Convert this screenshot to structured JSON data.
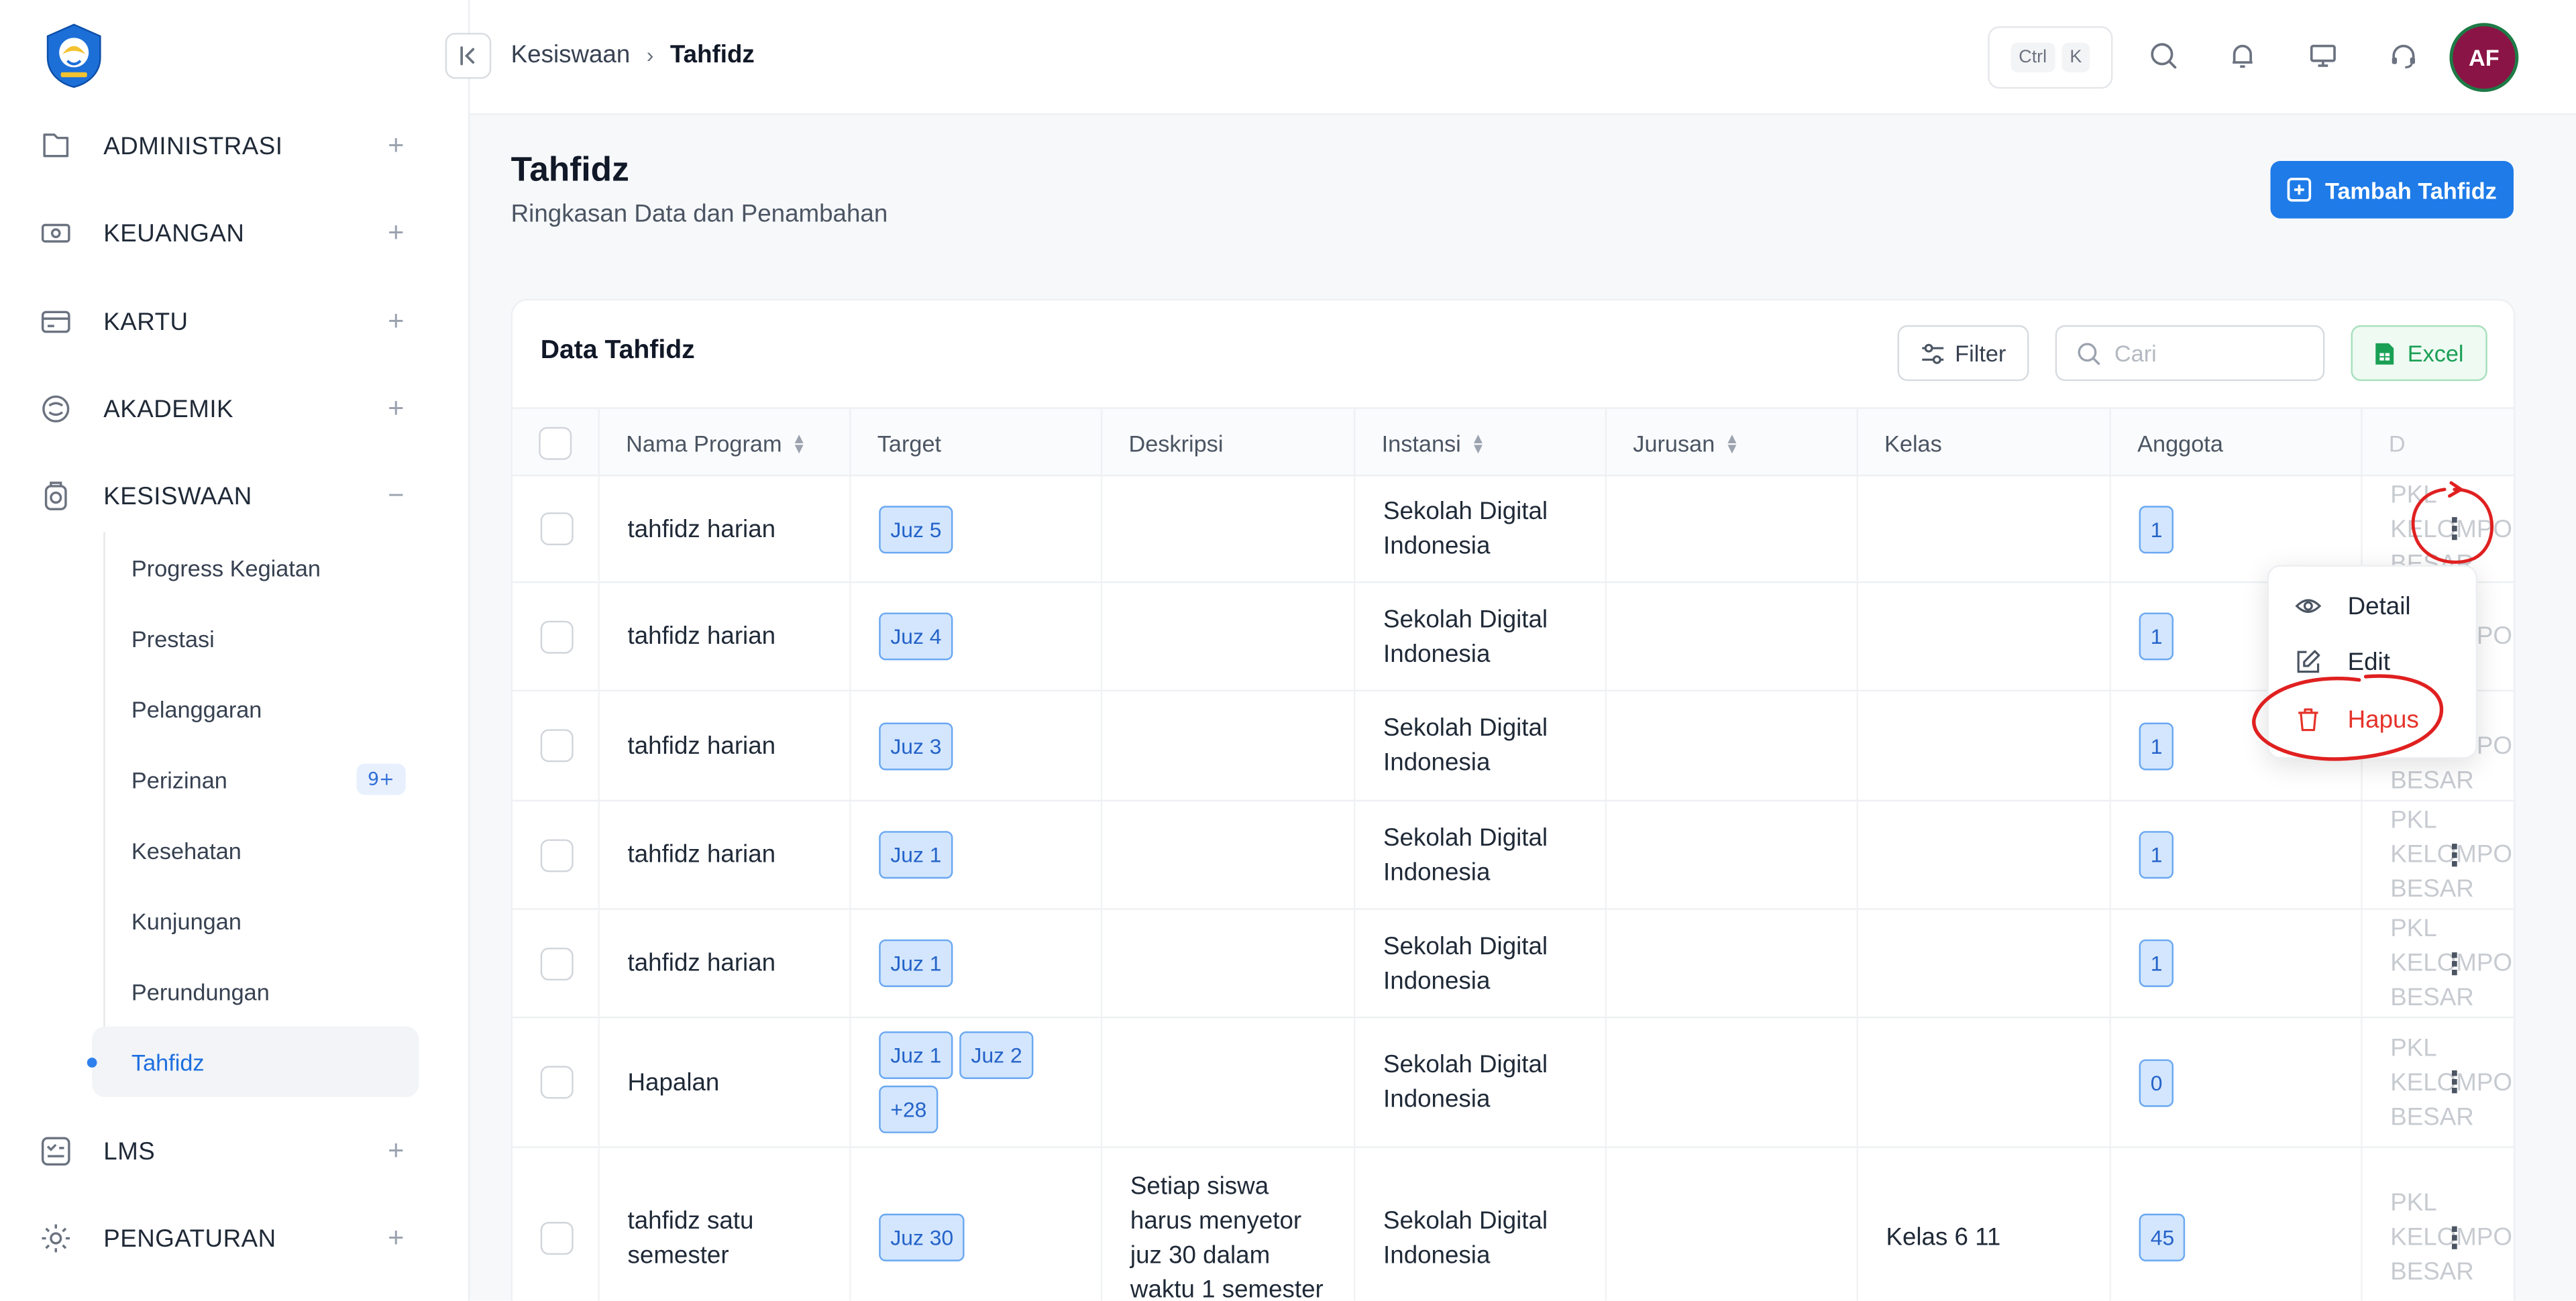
{
  "sidebar": {
    "groups": [
      {
        "label": "ADMINISTRASI",
        "toggle": "+"
      },
      {
        "label": "KEUANGAN",
        "toggle": "+"
      },
      {
        "label": "KARTU",
        "toggle": "+"
      },
      {
        "label": "AKADEMIK",
        "toggle": "+"
      },
      {
        "label": "KESISWAAN",
        "toggle": "−"
      },
      {
        "label": "LMS",
        "toggle": "+"
      },
      {
        "label": "PENGATURAN",
        "toggle": "+"
      }
    ],
    "submenu": [
      {
        "label": "Progress Kegiatan"
      },
      {
        "label": "Prestasi"
      },
      {
        "label": "Pelanggaran"
      },
      {
        "label": "Perizinan",
        "badge": "9+"
      },
      {
        "label": "Kesehatan"
      },
      {
        "label": "Kunjungan"
      },
      {
        "label": "Perundungan"
      },
      {
        "label": "Tahfidz"
      }
    ]
  },
  "topbar": {
    "breadcrumb": [
      "Kesiswaan",
      "Tahfidz"
    ],
    "shortcut_keys": [
      "Ctrl",
      "K"
    ],
    "avatar_initials": "AF",
    "avatar_color": "#8a1445"
  },
  "page": {
    "title": "Tahfidz",
    "subtitle": "Ringkasan Data dan Penambahan",
    "add_button": "Tambah Tahfidz",
    "primary_color": "#1e7be8"
  },
  "card": {
    "title": "Data Tahfidz",
    "filter_label": "Filter",
    "search_placeholder": "Cari",
    "excel_label": "Excel"
  },
  "table": {
    "columns": [
      "Nama Program",
      "Target",
      "Deskripsi",
      "Instansi",
      "Jurusan",
      "Kelas",
      "Anggota",
      "D"
    ],
    "rows": [
      {
        "nama": "tahfidz harian",
        "target": [
          "Juz 5"
        ],
        "deskripsi": "",
        "instansi": "Sekolah Digital Indonesia",
        "jurusan": "",
        "kelas": "",
        "anggota": "1",
        "extra": "PKL KELOMPOK BESAR"
      },
      {
        "nama": "tahfidz harian",
        "target": [
          "Juz 4"
        ],
        "deskripsi": "",
        "instansi": "Sekolah Digital Indonesia",
        "jurusan": "",
        "kelas": "",
        "anggota": "1",
        "extra": "PKL KELOMPOK BESAR"
      },
      {
        "nama": "tahfidz harian",
        "target": [
          "Juz 3"
        ],
        "deskripsi": "",
        "instansi": "Sekolah Digital Indonesia",
        "jurusan": "",
        "kelas": "",
        "anggota": "1",
        "extra": "PKL KELOMPOK BESAR"
      },
      {
        "nama": "tahfidz harian",
        "target": [
          "Juz 1"
        ],
        "deskripsi": "",
        "instansi": "Sekolah Digital Indonesia",
        "jurusan": "",
        "kelas": "",
        "anggota": "1",
        "extra": "PKL KELOMPOK BESAR"
      },
      {
        "nama": "tahfidz harian",
        "target": [
          "Juz 1"
        ],
        "deskripsi": "",
        "instansi": "Sekolah Digital Indonesia",
        "jurusan": "",
        "kelas": "",
        "anggota": "1",
        "extra": "PKL KELOMPOK BESAR"
      },
      {
        "nama": "Hapalan",
        "target": [
          "Juz 1",
          "Juz 2",
          "+28"
        ],
        "deskripsi": "",
        "instansi": "Sekolah Digital Indonesia",
        "jurusan": "",
        "kelas": "",
        "anggota": "0",
        "extra": "PKL KELOMPOK BESAR"
      },
      {
        "nama": "tahfidz satu semester",
        "target": [
          "Juz 30"
        ],
        "deskripsi": "Setiap siswa harus menyetor juz 30 dalam waktu 1 semester",
        "instansi": "Sekolah Digital Indonesia",
        "jurusan": "",
        "kelas": "Kelas 6 11",
        "anggota": "45",
        "extra": "PKL KELOMPOK BESAR"
      }
    ]
  },
  "row_menu": {
    "items": [
      {
        "label": "Detail",
        "icon": "eye-icon"
      },
      {
        "label": "Edit",
        "icon": "edit-icon"
      },
      {
        "label": "Hapus",
        "icon": "trash-icon"
      }
    ],
    "danger_color": "#e5332a"
  },
  "annotation_color": "#e02020"
}
